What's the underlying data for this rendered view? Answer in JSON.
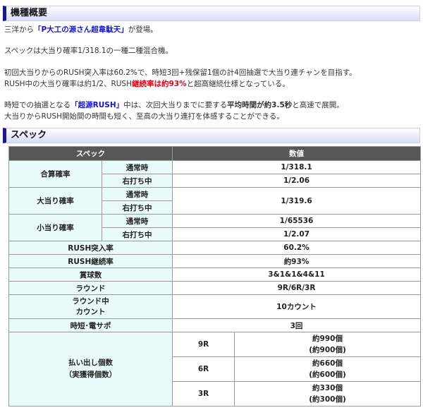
{
  "overview": {
    "title": "機種概要",
    "line1": {
      "prefix": "三洋から",
      "highlight": "「P大工の源さん超韋駄天」",
      "suffix": "が登場。"
    },
    "line2": "スペックは大当り確率1/318.1の一種二種混合機。",
    "line3": "初回大当りからのRUSH突入率は60.2%で、時短3回+残保留1個の計4回抽選で大当り連チャンを目指す。",
    "line4": {
      "prefix": "RUSH中の大当り確率は約1/2、RUSH",
      "highlight": "継続率は約93%",
      "suffix": "と超高継続仕様となっている。"
    },
    "line5": {
      "prefix": "時短での抽選となる",
      "highlight": "「超源RUSH」",
      "mid": "中は、次回大当りまでに要する",
      "bold": "平均時間が約3.5秒",
      "suffix": "と高速で展開。"
    },
    "line6": "大当りからRUSH開始間の時間も短く、至高の大当り連打を体感することができる。"
  },
  "spec": {
    "title": "スペック",
    "header": {
      "col1": "スペック",
      "col2": "数値"
    },
    "rows": {
      "gousan": {
        "label": "合算確率",
        "sub1": "通常時",
        "val1": "1/318.1",
        "sub2": "右打ち中",
        "val2": "1/2.06"
      },
      "ootari": {
        "label": "大当り確率",
        "sub1": "通常時",
        "sub2": "右打ち中",
        "val": "1/319.6"
      },
      "koatari": {
        "label": "小当り確率",
        "sub1": "通常時",
        "val1": "1/65536",
        "sub2": "右打ち中",
        "val2": "1/2.07"
      },
      "rush_in": {
        "label": "RUSH突入率",
        "val": "60.2%"
      },
      "rush_cont": {
        "label": "RUSH継続率",
        "val": "約93%"
      },
      "prize": {
        "label": "賞球数",
        "val": "3&1&1&4&11"
      },
      "round": {
        "label": "ラウンド",
        "val": "9R/6R/3R"
      },
      "round_count": {
        "label1": "ラウンド中",
        "label2": "カウント",
        "val": "10カウント"
      },
      "jitan": {
        "label": "時短･電サポ",
        "val": "3回"
      },
      "payout": {
        "label1": "払い出し個数",
        "label2": "（実獲得個数）",
        "items": [
          {
            "r": "9R",
            "v1": "約990個",
            "v2": "(約900個)"
          },
          {
            "r": "6R",
            "v1": "約660個",
            "v2": "(約600個)"
          },
          {
            "r": "3R",
            "v1": "約330個",
            "v2": "(約300個)"
          }
        ]
      }
    }
  }
}
